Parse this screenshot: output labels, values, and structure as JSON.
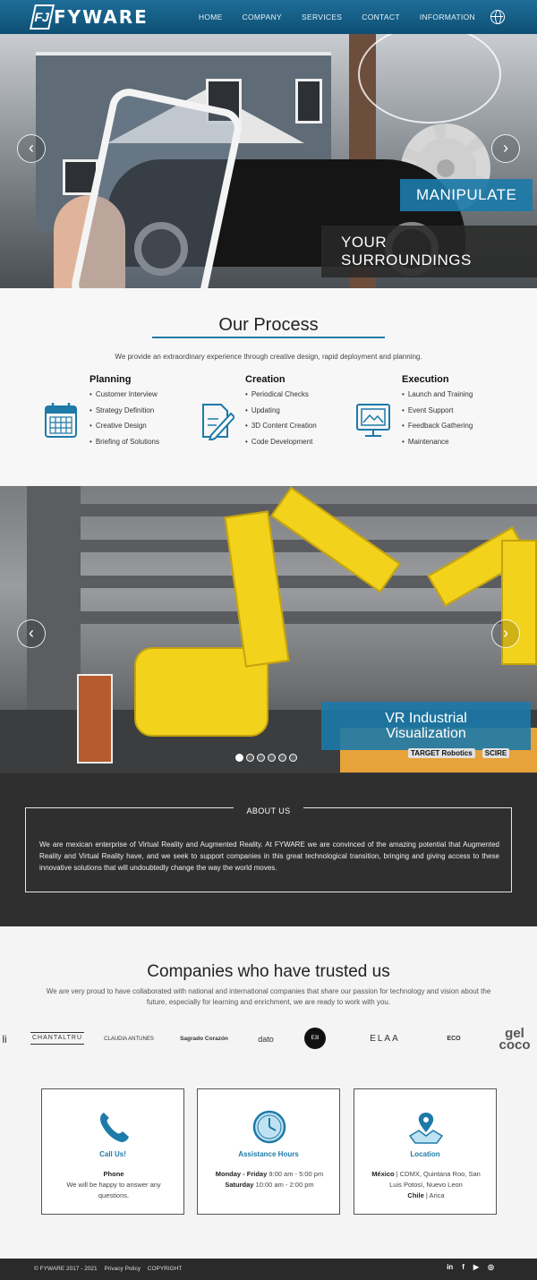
{
  "nav": {
    "logo_text": "FYWARE",
    "items": [
      "HOME",
      "COMPANY",
      "SERVICES",
      "CONTACT",
      "INFORMATION"
    ],
    "globe_icon": "globe-icon"
  },
  "hero": {
    "caption_top": "MANIPULATE",
    "caption_bottom": "YOUR SURROUNDINGS",
    "prev": "‹",
    "next": "›"
  },
  "process": {
    "title": "Our Process",
    "intro": "We provide an extraordinary experience through creative design, rapid deployment and planning.",
    "columns": [
      {
        "title": "Planning",
        "icon": "calendar-icon",
        "items": [
          "Customer Interview",
          "Strategy Definition",
          "Creative Design",
          "Briefing of Solutions"
        ]
      },
      {
        "title": "Creation",
        "icon": "document-edit-icon",
        "items": [
          "Periodical Checks",
          "Updating",
          "3D Content Creation",
          "Code Development"
        ]
      },
      {
        "title": "Execution",
        "icon": "monitor-icon",
        "items": [
          "Launch and Training",
          "Event Support",
          "Feedback Gathering",
          "Maintenance"
        ]
      }
    ]
  },
  "vr": {
    "caption_line1": "VR Industrial",
    "caption_line2": "Visualization",
    "logos": [
      "TARGET Robotics",
      "SCIRE"
    ],
    "slide_count": 6,
    "active_slide": 1
  },
  "about": {
    "title": "ABOUT US",
    "text": "We are mexican enterprise of Virtual Reality and Augmented Reality. At FYWARE we are convinced of the amazing potential that Augmented Reality and Virtual Reality have, and we seek to support companies in this great technological transition, bringing and giving access to these innovative solutions that will undoubtedly change the way the world moves."
  },
  "companies": {
    "title": "Companies who have trusted us",
    "text": "We are very proud to have collaborated with national and international companies that share our passion for technology and vision about the future, especially for learning and enrichment, we are ready to work with you.",
    "logos": [
      "li",
      "CHANTALTRU",
      "CLAUDIA ANTUNES",
      "Sagrado Corazón",
      "dato",
      "E3I",
      "ELAA",
      "ECO",
      "gel coco"
    ]
  },
  "cards": [
    {
      "icon": "phone-icon",
      "title": "Call Us!",
      "line1_bold": "Phone",
      "line1": "",
      "line2": "We will be happy to answer any questions."
    },
    {
      "icon": "clock-icon",
      "title": "Assistance Hours",
      "line1_bold": "Monday - Friday",
      "line1": "9:00 am - 5:00 pm",
      "line2_bold": "Saturday",
      "line2": "10:00 am - 2:00 pm"
    },
    {
      "icon": "map-icon",
      "title": "Location",
      "line1_bold": "México",
      "line1": "| CDMX, Quintana Roo, San Luis Potosí, Nuevo Leon",
      "line2_bold": "Chile",
      "line2": "| Arica"
    }
  ],
  "footer": {
    "copyright": "© FYWARE 2017 - 2021",
    "privacy": "Privacy Policy",
    "copyright_link": "COPYRIGHT",
    "socials": [
      "in",
      "f",
      "▶",
      "◎"
    ]
  },
  "colors": {
    "brand_blue": "#1e7aa8",
    "dark": "#2f2f2f"
  }
}
